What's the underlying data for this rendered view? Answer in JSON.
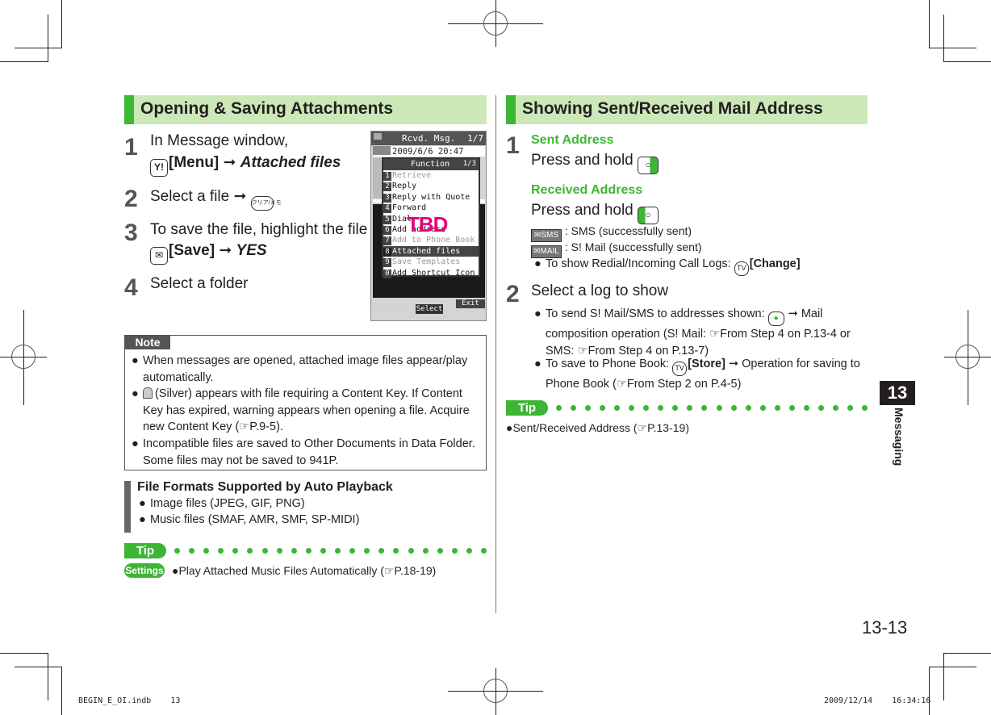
{
  "left_section": {
    "title": "Opening & Saving Attachments",
    "steps": [
      {
        "num": "1",
        "line1": "In Message window,",
        "key": "Y!",
        "menu_label": "[Menu]",
        "arrow": "➞",
        "target": "Attached files"
      },
      {
        "num": "2",
        "text": "Select a file",
        "arrow": "➞",
        "key": "クリア/メモ"
      },
      {
        "num": "3",
        "line1": "To save the file, highlight the file",
        "arrow": "➞",
        "key": "mail-key",
        "save_label": "[Save]",
        "target": "YES"
      },
      {
        "num": "4",
        "text": "Select a folder"
      }
    ],
    "phone_screen": {
      "title": "Rcvd. Msg.",
      "page": "1/7",
      "datetime": "2009/6/6 20:47",
      "menu_title": "Function",
      "menu_page": "1/3",
      "menu_items": [
        {
          "num": "1",
          "label": "Retrieve",
          "state": "disabled"
        },
        {
          "num": "2",
          "label": "Reply",
          "state": "normal"
        },
        {
          "num": "3",
          "label": "Reply with Quote",
          "state": "normal"
        },
        {
          "num": "4",
          "label": "Forward",
          "state": "normal"
        },
        {
          "num": "5",
          "label": "Dial",
          "state": "normal"
        },
        {
          "num": "6",
          "label": "Add address",
          "state": "normal"
        },
        {
          "num": "7",
          "label": "Add to Phone Book",
          "state": "disabled"
        },
        {
          "num": "8",
          "label": "Attached files",
          "state": "selected"
        },
        {
          "num": "9",
          "label": "Save Templates",
          "state": "disabled"
        },
        {
          "num": "0",
          "label": "Add Shortcut Icon",
          "state": "normal"
        }
      ],
      "overlay_text": "TBD",
      "softkey_center": "Select",
      "softkey_right": "Exit"
    },
    "note": {
      "label": "Note",
      "items": [
        "When messages are opened, attached image files appear/play automatically.",
        "(Silver) appears with file requiring a Content Key. If Content Key has expired, warning appears when opening a file. Acquire new Content Key (☞P.9-5).",
        "Incompatible files are saved to Other Documents in Data Folder. Some files may not be saved to 941P."
      ]
    },
    "file_formats": {
      "title": "File Formats Supported by Auto Playback",
      "items": [
        "Image files (JPEG, GIF, PNG)",
        "Music files (SMAF, AMR, SMF, SP-MIDI)"
      ]
    },
    "tip": {
      "label": "Tip",
      "settings_badge": "Settings",
      "item": "●Play Attached Music Files Automatically (☞P.18-19)"
    }
  },
  "right_section": {
    "title": "Showing Sent/Received Mail Address",
    "step1": {
      "num": "1",
      "sent_heading": "Sent Address",
      "sent_text": "Press and hold",
      "received_heading": "Received Address",
      "received_text": "Press and hold",
      "icon_sms_label": "SMS",
      "icon_sms_desc": ": SMS (successfully sent)",
      "icon_mail_label": "MAIL",
      "icon_mail_desc": ": S! Mail (successfully sent)",
      "bullet": "To show Redial/Incoming Call Logs:",
      "bullet_action": "[Change]"
    },
    "step2": {
      "num": "2",
      "text": "Select a log to show",
      "bullets": [
        {
          "pre": "To send S! Mail/SMS to addresses shown:",
          "post": "➞ Mail composition operation (S! Mail: ☞From Step 4 on P.13-4 or SMS: ☞From Step 4 on P.13-7)"
        },
        {
          "pre": "To save to Phone Book:",
          "action": "[Store]",
          "post": "➞ Operation for saving to Phone Book (☞From Step 2 on P.4-5)"
        }
      ]
    },
    "tip": {
      "label": "Tip",
      "item": "●Sent/Received Address (☞P.13-19)"
    }
  },
  "chapter": {
    "number": "13",
    "label": "Messaging"
  },
  "page_number": "13-13",
  "slug": {
    "file": "BEGIN_E_OI.indb    13",
    "timestamp": "2009/12/14    16:34:16"
  },
  "colors": {
    "accent_green": "#3db535",
    "header_bg": "#cce8b8",
    "highlight_pink": "#e6007e"
  }
}
